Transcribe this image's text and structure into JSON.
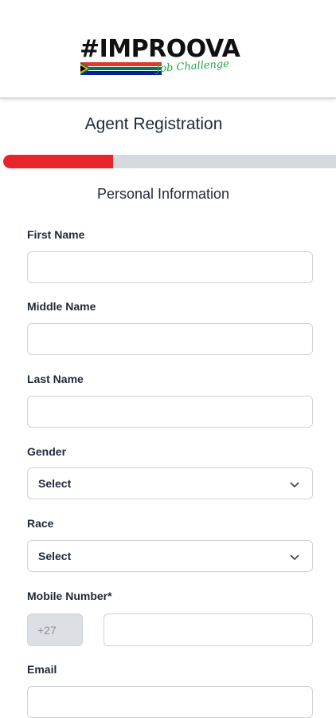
{
  "header": {
    "logo_text": "#IMPROOVA",
    "logo_tagline": "Job Challenge"
  },
  "page": {
    "title": "Agent Registration",
    "progress_fraction": 0.33,
    "section_title": "Personal Information"
  },
  "form": {
    "first_name": {
      "label": "First Name",
      "value": ""
    },
    "middle_name": {
      "label": "Middle Name",
      "value": ""
    },
    "last_name": {
      "label": "Last Name",
      "value": ""
    },
    "gender": {
      "label": "Gender",
      "selected": "Select"
    },
    "race": {
      "label": "Race",
      "selected": "Select"
    },
    "mobile": {
      "label": "Mobile Number*",
      "country_code": "+27",
      "value": ""
    },
    "email": {
      "label": "Email",
      "value": ""
    }
  },
  "colors": {
    "progress_fill": "#e8232b",
    "progress_track": "#d6d9de",
    "flag_green": "#007a4d",
    "flag_red": "#de3831",
    "flag_blue": "#002395",
    "flag_gold": "#ffb612"
  },
  "icons": {
    "dropdown": "chevron-down-icon",
    "flag": "south-africa-flag-icon"
  }
}
